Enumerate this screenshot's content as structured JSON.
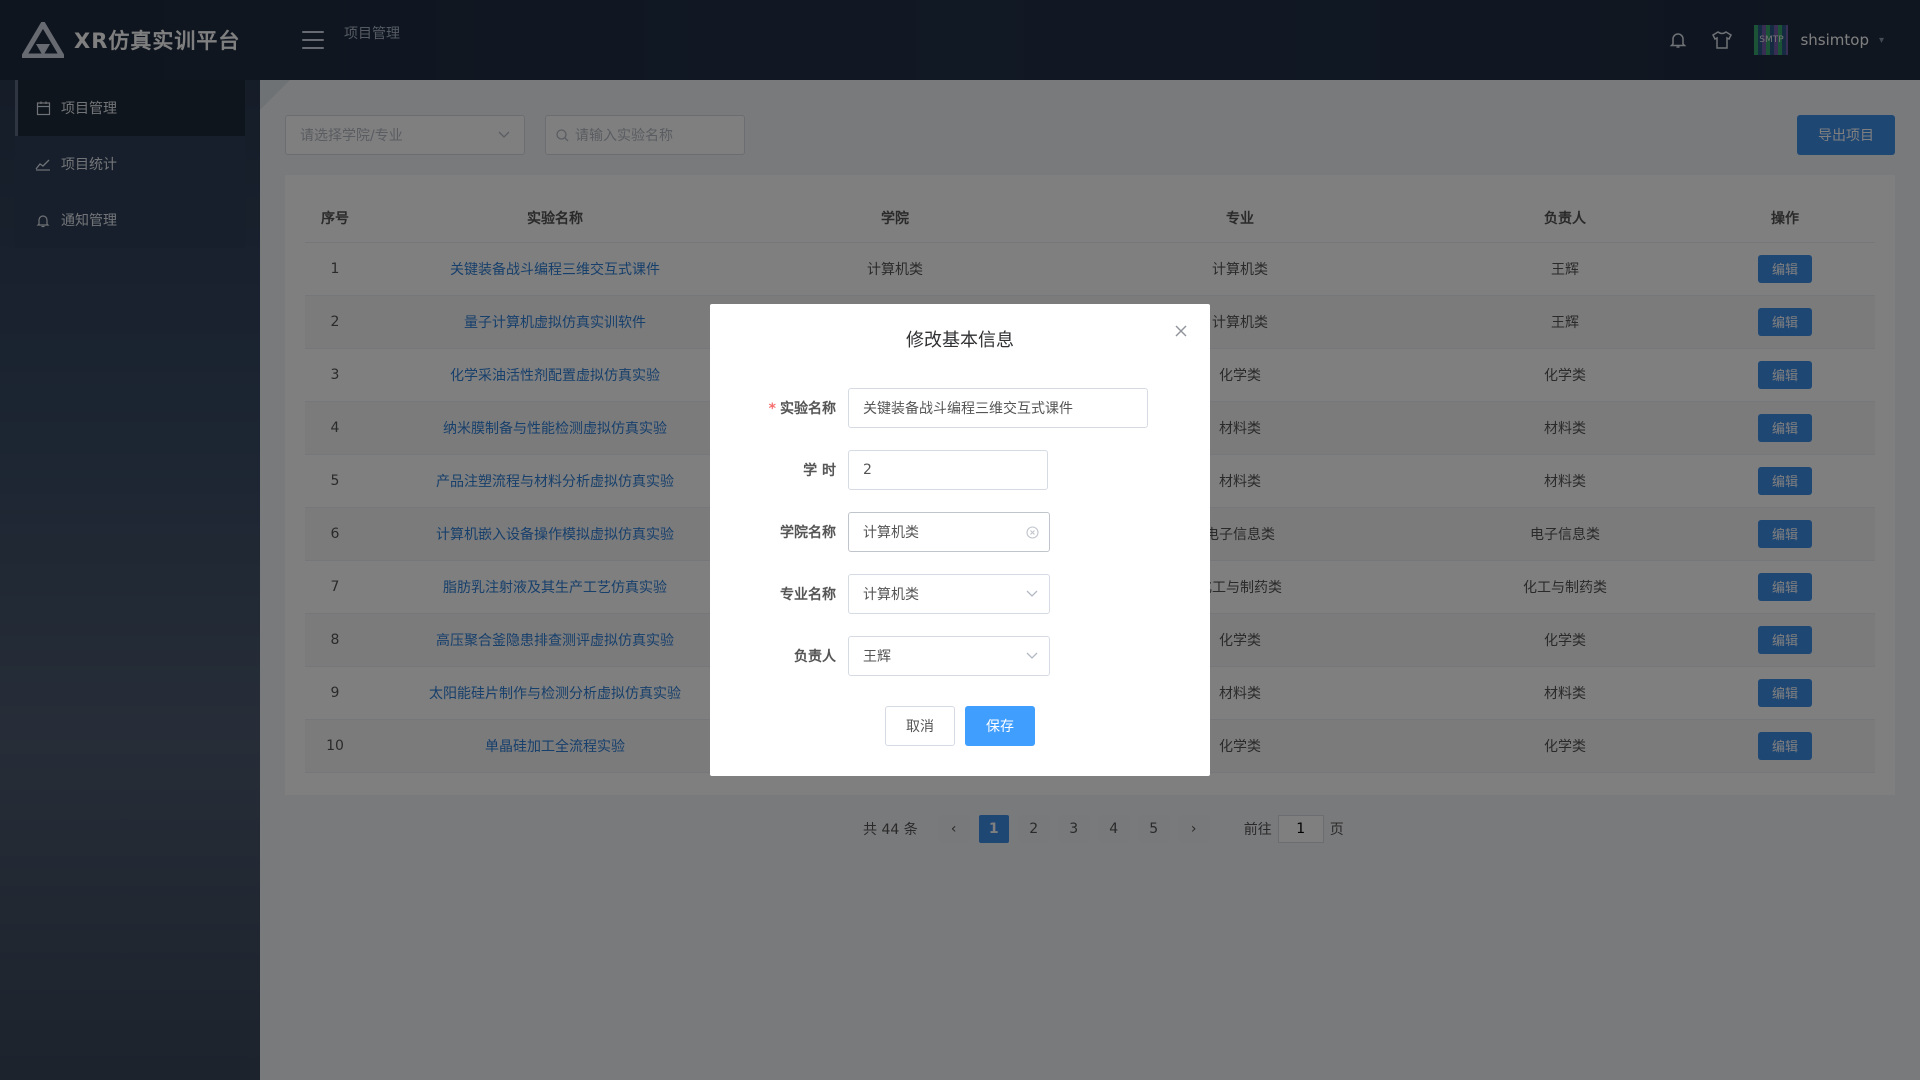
{
  "header": {
    "app_title": "XR仿真实训平台",
    "breadcrumb": "项目管理",
    "username": "shsimtop",
    "avatar_text": "SMTP"
  },
  "sidebar": {
    "items": [
      {
        "label": "项目管理",
        "icon": "calendar-icon",
        "active": true
      },
      {
        "label": "项目统计",
        "icon": "chart-icon",
        "active": false
      },
      {
        "label": "通知管理",
        "icon": "bell-icon",
        "active": false
      }
    ]
  },
  "toolbar": {
    "college_placeholder": "请选择学院/专业",
    "search_placeholder": "请输入实验名称",
    "export_label": "导出项目"
  },
  "table": {
    "columns": [
      "序号",
      "实验名称",
      "学院",
      "专业",
      "负责人",
      "操作"
    ],
    "edit_label": "编辑",
    "rows": [
      {
        "no": "1",
        "name": "关键装备战斗编程三维交互式课件",
        "college": "计算机类",
        "major": "计算机类",
        "owner": "王辉"
      },
      {
        "no": "2",
        "name": "量子计算机虚拟仿真实训软件",
        "college": "",
        "major": "计算机类",
        "owner": "王辉"
      },
      {
        "no": "3",
        "name": "化学采油活性剂配置虚拟仿真实验",
        "college": "",
        "major": "化学类",
        "owner": "化学类"
      },
      {
        "no": "4",
        "name": "纳米膜制备与性能检测虚拟仿真实验",
        "college": "",
        "major": "材料类",
        "owner": "材料类"
      },
      {
        "no": "5",
        "name": "产品注塑流程与材料分析虚拟仿真实验",
        "college": "",
        "major": "材料类",
        "owner": "材料类"
      },
      {
        "no": "6",
        "name": "计算机嵌入设备操作模拟虚拟仿真实验",
        "college": "",
        "major": "电子信息类",
        "owner": "电子信息类"
      },
      {
        "no": "7",
        "name": "脂肪乳注射液及其生产工艺仿真实验",
        "college": "",
        "major": "化工与制药类",
        "owner": "化工与制药类"
      },
      {
        "no": "8",
        "name": "高压聚合釜隐患排查测评虚拟仿真实验",
        "college": "",
        "major": "化学类",
        "owner": "化学类"
      },
      {
        "no": "9",
        "name": "太阳能硅片制作与检测分析虚拟仿真实验",
        "college": "",
        "major": "材料类",
        "owner": "材料类"
      },
      {
        "no": "10",
        "name": "单晶硅加工全流程实验",
        "college": "",
        "major": "化学类",
        "owner": "化学类"
      }
    ]
  },
  "pager": {
    "total": "共 44 条",
    "prev": "‹",
    "next": "›",
    "pages": [
      "1",
      "2",
      "3",
      "4",
      "5"
    ],
    "current": "1",
    "goto_prefix": "前往",
    "goto_value": "1",
    "goto_suffix": "页"
  },
  "modal": {
    "title": "修改基本信息",
    "fields": {
      "name_label": "实验名称",
      "name_value": "关键装备战斗编程三维交互式课件",
      "hours_label": "学 时",
      "hours_value": "2",
      "college_label": "学院名称",
      "college_value": "计算机类",
      "major_label": "专业名称",
      "major_value": "计算机类",
      "owner_label": "负责人",
      "owner_value": "王辉"
    },
    "cancel_label": "取消",
    "save_label": "保存"
  },
  "colors": {
    "accent": "#409eff",
    "link": "#2f7fd6",
    "header_bg": "#1e2a3d"
  }
}
